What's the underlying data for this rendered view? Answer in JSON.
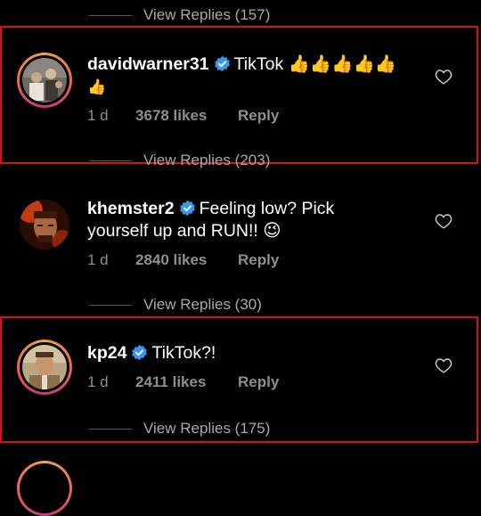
{
  "top_replies": {
    "label": "View Replies (157)"
  },
  "comments": [
    {
      "username": "davidwarner31",
      "text_line1": "TikTok 👍👍👍👍👍",
      "text_line2": "👍",
      "age": "1 d",
      "likes": "3678 likes",
      "reply_label": "Reply",
      "replies_label": "View Replies (203)",
      "highlighted": true
    },
    {
      "username": "khemster2",
      "text_line1": "Feeling low? Pick",
      "text_line2": "yourself up and RUN!! 😉",
      "age": "1 d",
      "likes": "2840 likes",
      "reply_label": "Reply",
      "replies_label": "View Replies (30)",
      "highlighted": false
    },
    {
      "username": "kp24",
      "text_line1": "TikTok?!",
      "age": "1 d",
      "likes": "2411 likes",
      "reply_label": "Reply",
      "replies_label": "View Replies (175)",
      "highlighted": true
    }
  ],
  "colors": {
    "background": "#000000",
    "highlight_box": "#d41414",
    "verified_badge": "#3897f0",
    "muted_text": "#8e8e8e"
  },
  "icons": [
    "verified-badge-icon",
    "heart-outline-icon"
  ]
}
